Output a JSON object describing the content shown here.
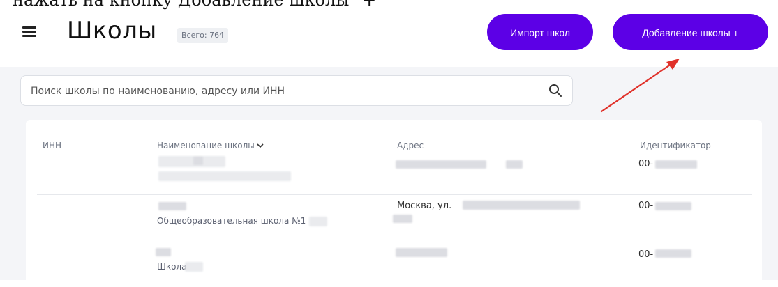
{
  "caption": "нажать на кнопку Добавление школы \"+\"",
  "header": {
    "title": "Школы",
    "total_label": "Всего: 764",
    "import_button": "Импорт школ",
    "add_button": "Добавление школы  +"
  },
  "search": {
    "placeholder": "Поиск школы по наименованию, адресу или ИНН"
  },
  "table": {
    "columns": [
      "ИНН",
      "Наименование школы",
      "Адрес",
      "Идентификатор"
    ],
    "rows": [
      {
        "inn": "",
        "name": "",
        "address": "",
        "id_prefix": "00-"
      },
      {
        "inn": "",
        "name": "Общеобразовательная школа №1",
        "address": "Москва, ул.",
        "id_prefix": "00-"
      },
      {
        "inn": "",
        "name": "Школа",
        "address": "",
        "id_prefix": "00-"
      }
    ]
  },
  "colors": {
    "accent": "#5c00e6",
    "annotation_arrow": "#e0312a",
    "page_bg": "#f4f5f8"
  },
  "icons": {
    "menu": "hamburger-icon",
    "search": "search-icon",
    "sort": "chevron-down-icon"
  }
}
